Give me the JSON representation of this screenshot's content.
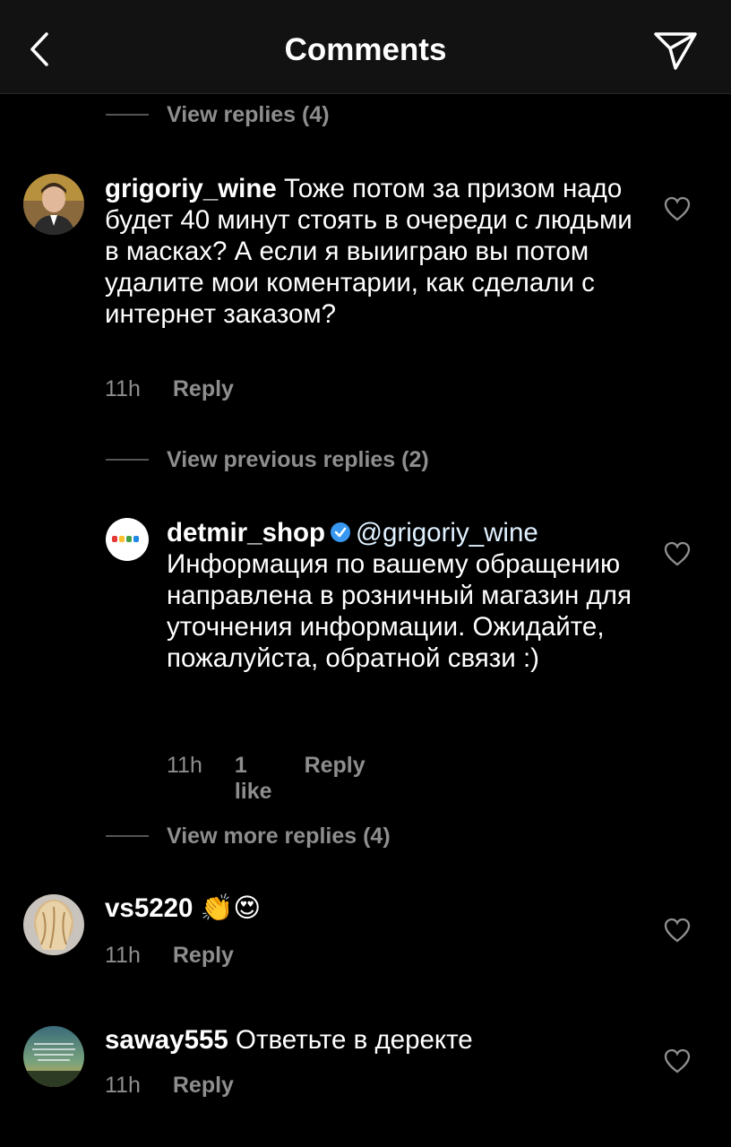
{
  "header": {
    "title": "Comments"
  },
  "threads": {
    "view_replies_top": "View replies (4)",
    "view_previous": "View previous replies (2)",
    "view_more": "View more replies (4)"
  },
  "comments": [
    {
      "username": "grigoriy_wine",
      "text": "Тоже потом за призом надо будет 40 минут стоять в очереди с людьми в масках? А если я выииграю вы потом удалите мои коментарии, как сделали с интернет заказом?",
      "time": "11h",
      "reply": "Reply"
    },
    {
      "username": "detmir_shop",
      "mention": "@grigoriy_wine",
      "text": "Информация по вашему обращению направлена в розничный магазин для уточнения информации. Ожидайте, пожалуйста, обратной связи :)",
      "time": "11h",
      "likes": "1 like",
      "reply": "Reply"
    },
    {
      "username": "vs5220",
      "text": "👏😍",
      "time": "11h",
      "reply": "Reply"
    },
    {
      "username": "saway555",
      "text": "Ответьте в деректе",
      "time": "11h",
      "reply": "Reply"
    }
  ],
  "colors": {
    "background": "#000000",
    "header_bg": "#121212",
    "secondary_text": "#8e8e8e",
    "verified_blue": "#3897f0"
  }
}
